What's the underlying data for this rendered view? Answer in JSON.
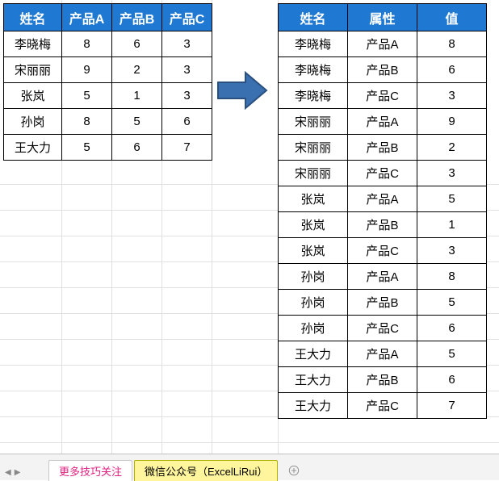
{
  "chart_data": [
    {
      "type": "table",
      "title": "wide",
      "columns": [
        "姓名",
        "产品A",
        "产品B",
        "产品C"
      ],
      "rows": [
        [
          "李晓梅",
          8,
          6,
          3
        ],
        [
          "宋丽丽",
          9,
          2,
          3
        ],
        [
          "张岚",
          5,
          1,
          3
        ],
        [
          "孙岗",
          8,
          5,
          6
        ],
        [
          "王大力",
          5,
          6,
          7
        ]
      ]
    },
    {
      "type": "table",
      "title": "long",
      "columns": [
        "姓名",
        "属性",
        "值"
      ],
      "rows": [
        [
          "李晓梅",
          "产品A",
          8
        ],
        [
          "李晓梅",
          "产品B",
          6
        ],
        [
          "李晓梅",
          "产品C",
          3
        ],
        [
          "宋丽丽",
          "产品A",
          9
        ],
        [
          "宋丽丽",
          "产品B",
          2
        ],
        [
          "宋丽丽",
          "产品C",
          3
        ],
        [
          "张岚",
          "产品A",
          5
        ],
        [
          "张岚",
          "产品B",
          1
        ],
        [
          "张岚",
          "产品C",
          3
        ],
        [
          "孙岗",
          "产品A",
          8
        ],
        [
          "孙岗",
          "产品B",
          5
        ],
        [
          "孙岗",
          "产品C",
          6
        ],
        [
          "王大力",
          "产品A",
          5
        ],
        [
          "王大力",
          "产品B",
          6
        ],
        [
          "王大力",
          "产品C",
          7
        ]
      ]
    }
  ],
  "left_table": {
    "headers": [
      "姓名",
      "产品A",
      "产品B",
      "产品C"
    ],
    "rows": [
      {
        "name": "李晓梅",
        "a": "8",
        "b": "6",
        "c": "3"
      },
      {
        "name": "宋丽丽",
        "a": "9",
        "b": "2",
        "c": "3"
      },
      {
        "name": "张岚",
        "a": "5",
        "b": "1",
        "c": "3"
      },
      {
        "name": "孙岗",
        "a": "8",
        "b": "5",
        "c": "6"
      },
      {
        "name": "王大力",
        "a": "5",
        "b": "6",
        "c": "7"
      }
    ]
  },
  "right_table": {
    "headers": [
      "姓名",
      "属性",
      "值"
    ],
    "rows": [
      {
        "name": "李晓梅",
        "attr": "产品A",
        "val": "8"
      },
      {
        "name": "李晓梅",
        "attr": "产品B",
        "val": "6"
      },
      {
        "name": "李晓梅",
        "attr": "产品C",
        "val": "3"
      },
      {
        "name": "宋丽丽",
        "attr": "产品A",
        "val": "9"
      },
      {
        "name": "宋丽丽",
        "attr": "产品B",
        "val": "2"
      },
      {
        "name": "宋丽丽",
        "attr": "产品C",
        "val": "3"
      },
      {
        "name": "张岚",
        "attr": "产品A",
        "val": "5"
      },
      {
        "name": "张岚",
        "attr": "产品B",
        "val": "1"
      },
      {
        "name": "张岚",
        "attr": "产品C",
        "val": "3"
      },
      {
        "name": "孙岗",
        "attr": "产品A",
        "val": "8"
      },
      {
        "name": "孙岗",
        "attr": "产品B",
        "val": "5"
      },
      {
        "name": "孙岗",
        "attr": "产品C",
        "val": "6"
      },
      {
        "name": "王大力",
        "attr": "产品A",
        "val": "5"
      },
      {
        "name": "王大力",
        "attr": "产品B",
        "val": "6"
      },
      {
        "name": "王大力",
        "attr": "产品C",
        "val": "7"
      }
    ]
  },
  "arrow": {
    "color": "#3a6fb0",
    "stroke": "#2a5080"
  },
  "tabs": {
    "left_label": "更多技巧关注",
    "active_label": "微信公众号（ExcelLiRui）"
  }
}
